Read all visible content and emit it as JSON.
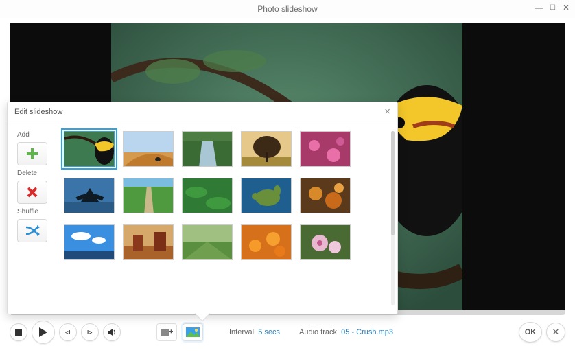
{
  "window": {
    "title": "Photo slideshow"
  },
  "popover": {
    "title": "Edit slideshow",
    "sidebar": {
      "add_label": "Add",
      "delete_label": "Delete",
      "shuffle_label": "Shuffle"
    },
    "selected_index": 0,
    "thumbs": [
      {
        "name": "tropical-bird"
      },
      {
        "name": "desert-dune"
      },
      {
        "name": "forest-stream"
      },
      {
        "name": "lone-tree"
      },
      {
        "name": "pink-flowers"
      },
      {
        "name": "whale-tail"
      },
      {
        "name": "green-path"
      },
      {
        "name": "jungle-leaves"
      },
      {
        "name": "sea-turtle"
      },
      {
        "name": "autumn-leaves"
      },
      {
        "name": "blue-sky"
      },
      {
        "name": "monument-valley"
      },
      {
        "name": "green-field"
      },
      {
        "name": "orange-flowers"
      },
      {
        "name": "blossom-closeup"
      }
    ]
  },
  "controls": {
    "interval_label": "Interval",
    "interval_value": "5 secs",
    "audio_label": "Audio track",
    "audio_value": "05 - Crush.mp3",
    "ok_label": "OK"
  }
}
